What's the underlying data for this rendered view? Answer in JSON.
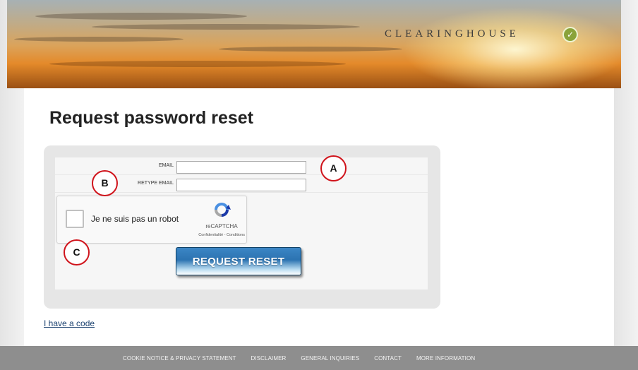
{
  "header": {
    "logo_text": "CLEARINGHOUSE",
    "logo_icon": "check-circle-icon",
    "accent_color": "#8aa33a"
  },
  "page": {
    "title": "Request password reset"
  },
  "form": {
    "email_label": "EMAIL",
    "email_value": "",
    "retype_email_label": "RETYPE EMAIL",
    "retype_email_value": "",
    "captcha": {
      "label": "Je ne suis pas un robot",
      "brand": "reCAPTCHA",
      "links": "Confidentialité - Conditions",
      "icon": "recaptcha-icon"
    },
    "submit_label": "REQUEST RESET"
  },
  "links": {
    "have_code": "I have a code"
  },
  "annotations": {
    "a": "A",
    "b": "B",
    "c": "C",
    "color": "#d0141c"
  },
  "footer": {
    "links": [
      "COOKIE NOTICE & PRIVACY STATEMENT",
      "DISCLAIMER",
      "GENERAL INQUIRIES",
      "CONTACT",
      "MORE INFORMATION"
    ]
  }
}
